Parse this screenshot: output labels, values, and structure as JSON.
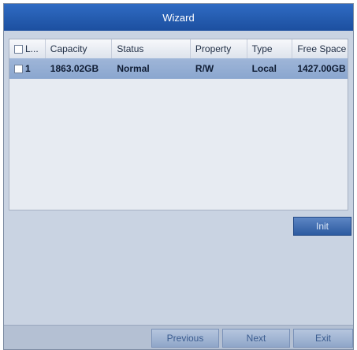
{
  "window": {
    "title": "Wizard"
  },
  "table": {
    "columns": [
      "L...",
      "Capacity",
      "Status",
      "Property",
      "Type",
      "Free Space"
    ],
    "rows": [
      {
        "label": "1",
        "capacity": "1863.02GB",
        "status": "Normal",
        "property": "R/W",
        "type": "Local",
        "free_space": "1427.00GB",
        "selected": false
      }
    ]
  },
  "actions": {
    "init_label": "Init"
  },
  "nav": {
    "previous_label": "Previous",
    "next_label": "Next",
    "exit_label": "Exit"
  },
  "colors": {
    "title_bar": "#1c4f9f",
    "selected_row": "#8aa6cf",
    "button": "#2c5aa0",
    "background": "#c9d3e2"
  }
}
